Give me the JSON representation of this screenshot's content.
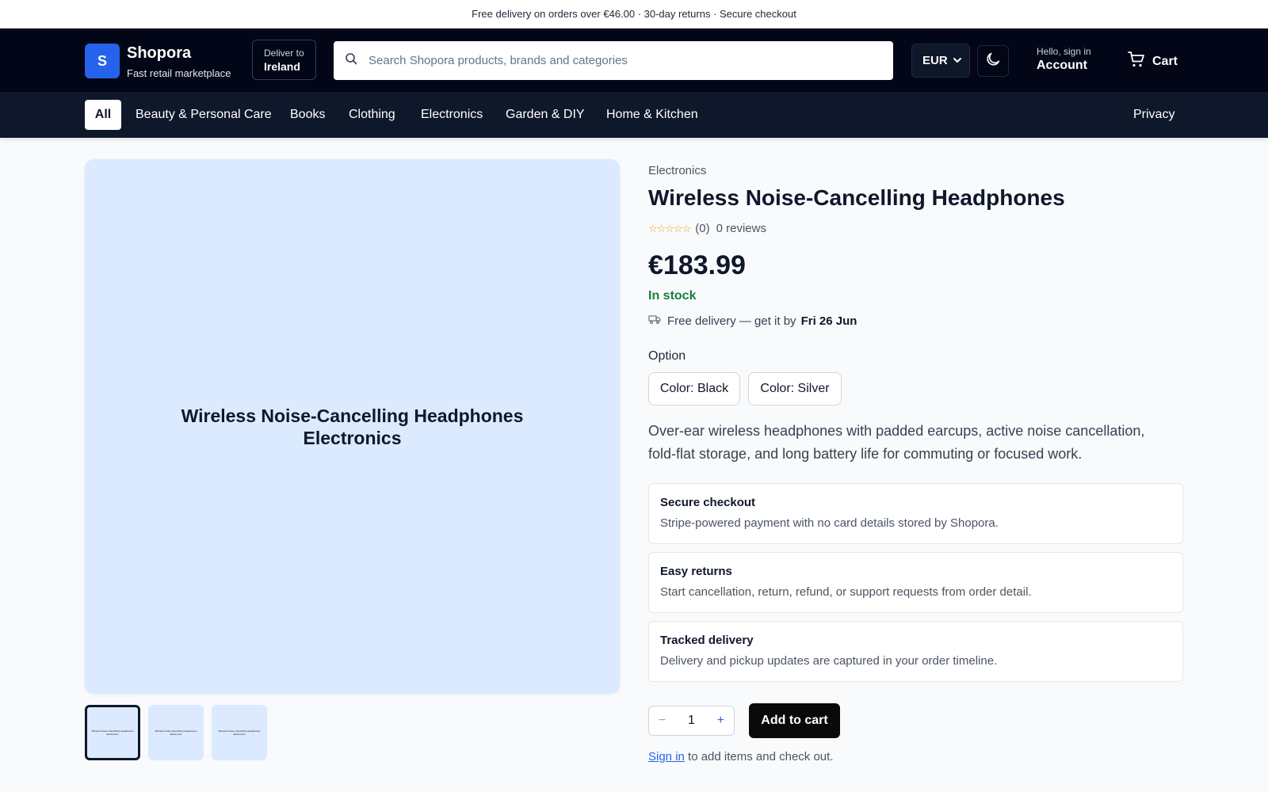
{
  "promo": {
    "text": "Free delivery on orders over €46.00 · 30-day returns · Secure checkout"
  },
  "header": {
    "logo_letter": "S",
    "brand_name": "Shopora",
    "brand_tagline": "Fast retail marketplace",
    "deliver_to_label": "Deliver to",
    "deliver_to_value": "Ireland",
    "search_placeholder": "Search Shopora products, brands and categories",
    "currency": "EUR",
    "account_greeting": "Hello, sign in",
    "account_label": "Account",
    "cart_label": "Cart",
    "colors": {
      "bar": "#020617",
      "logo": "#2563eb"
    }
  },
  "nav": {
    "all_label": "All",
    "categories": [
      "Beauty & Personal Care",
      "Books",
      "Clothing",
      "Electronics",
      "Garden & DIY",
      "Home & Kitchen"
    ],
    "privacy_label": "Privacy"
  },
  "gallery": {
    "main_title": "Wireless Noise-Cancelling Headphones",
    "main_subtitle": "Electronics",
    "thumb_title": "Wireless Noise-Cancelling Headphones",
    "thumb_subtitle": "Electronics",
    "selected_thumbnail": 1,
    "thumbnail_count": 3
  },
  "product": {
    "breadcrumb": "Electronics",
    "title": "Wireless Noise-Cancelling Headphones",
    "stars": "☆☆☆☆☆",
    "rating_count": "(0)",
    "reviews_label": "0 reviews",
    "price": "€183.99",
    "stock": "In stock",
    "delivery_text": "Free delivery — get it by",
    "delivery_date": "Fri 26 Jun",
    "option_label": "Option",
    "options": [
      "Color: Black",
      "Color: Silver"
    ],
    "description": "Over-ear wireless headphones with padded earcups, active noise cancellation, fold-flat storage, and long battery life for commuting or focused work.",
    "stock_color": "#15803d"
  },
  "features": [
    {
      "title": "Secure checkout",
      "desc": "Stripe-powered payment with no card details stored by Shopora."
    },
    {
      "title": "Easy returns",
      "desc": "Start cancellation, return, refund, or support requests from order detail."
    },
    {
      "title": "Tracked delivery",
      "desc": "Delivery and pickup updates are captured in your order timeline."
    }
  ],
  "purchase": {
    "quantity": "1",
    "minus": "−",
    "plus": "+",
    "add_to_cart": "Add to cart",
    "signin_link": "Sign in",
    "signin_suffix": " to add items and check out."
  }
}
